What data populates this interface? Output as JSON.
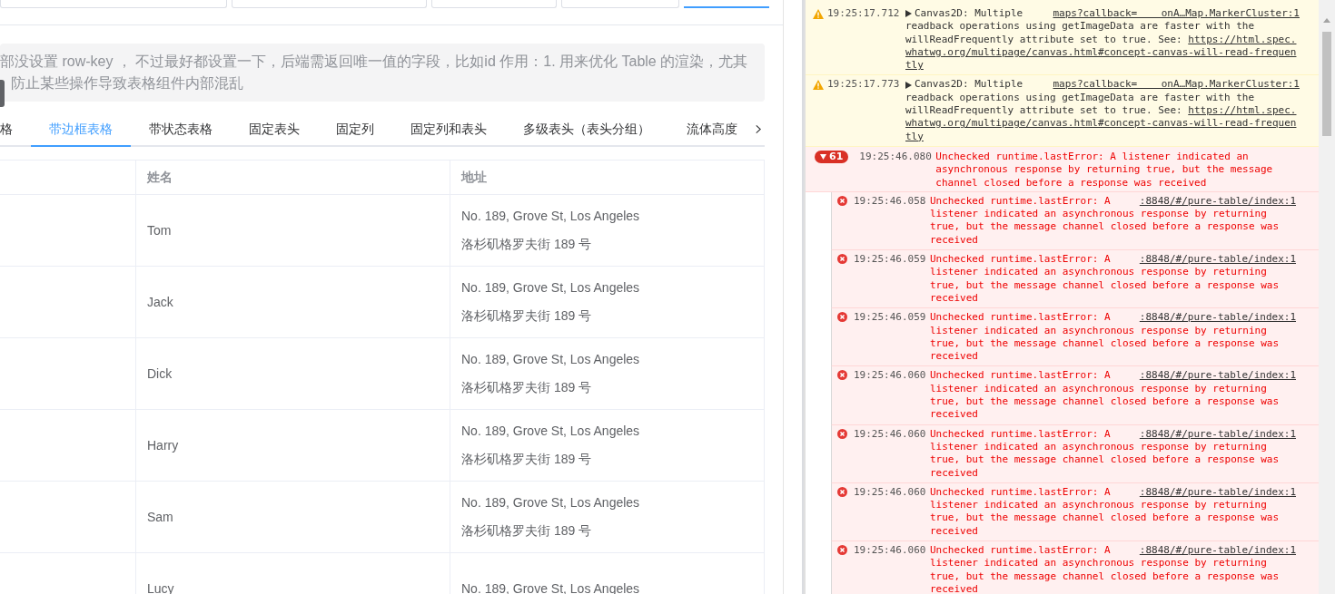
{
  "page_tabs": [
    {
      "selected": false
    },
    {
      "selected": false
    },
    {
      "selected": false
    },
    {
      "selected": false
    },
    {
      "selected": true
    }
  ],
  "note": {
    "text": "部没设置 row-key ， 不过最好都设置一下，后端需返回唯一值的字段，比如id 作用：1. 用来优化 Table 的渲染，尤其防止某些操作导致表格组件内部混乱"
  },
  "tabs": [
    {
      "label": "格",
      "selected": false
    },
    {
      "label": "带边框表格",
      "selected": true
    },
    {
      "label": "带状态表格",
      "selected": false
    },
    {
      "label": "固定表头",
      "selected": false
    },
    {
      "label": "固定列",
      "selected": false
    },
    {
      "label": "固定列和表头",
      "selected": false
    },
    {
      "label": "多级表头（表头分组）",
      "selected": false
    },
    {
      "label": "流体高度",
      "selected": false
    }
  ],
  "table": {
    "columns": [
      "姓名",
      "地址"
    ],
    "rows": [
      {
        "name": "Tom",
        "address": "No. 189, Grove St, Los Angeles",
        "address_zh": "洛杉矶格罗夫街 189 号"
      },
      {
        "name": "Jack",
        "address": "No. 189, Grove St, Los Angeles",
        "address_zh": "洛杉矶格罗夫街 189 号"
      },
      {
        "name": "Dick",
        "address": "No. 189, Grove St, Los Angeles",
        "address_zh": "洛杉矶格罗夫街 189 号"
      },
      {
        "name": "Harry",
        "address": "No. 189, Grove St, Los Angeles",
        "address_zh": "洛杉矶格罗夫街 189 号"
      },
      {
        "name": "Sam",
        "address": "No. 189, Grove St, Los Angeles",
        "address_zh": "洛杉矶格罗夫街 189 号"
      },
      {
        "name": "Lucy",
        "address": "No. 189, Grove St, Los Angeles"
      }
    ]
  },
  "console": [
    {
      "kind": "warning",
      "time": "19:25:17.712",
      "text_lines": [
        "Canvas2D: Multiple",
        "readback operations using getImageData are faster with the",
        "willReadFrequently attribute set to true. See:"
      ],
      "link_lines": [
        "https://html.spec.",
        "whatwg.org/multipage/canvas.html#concept-canvas-will-read-frequen",
        "tly"
      ],
      "source": "maps?callback=    onA…Map.MarkerCluster:1"
    },
    {
      "kind": "warning",
      "time": "19:25:17.773",
      "text_lines": [
        "Canvas2D: Multiple",
        "readback operations using getImageData are faster with the",
        "willReadFrequently attribute set to true. See:"
      ],
      "link_lines": [
        "https://html.spec.",
        "whatwg.org/multipage/canvas.html#concept-canvas-will-read-frequen",
        "tly"
      ],
      "source": "maps?callback=    onA…Map.MarkerCluster:1"
    },
    {
      "kind": "group",
      "count": "61",
      "expanded": true,
      "time": "19:25:46.080",
      "message": "Unchecked runtime.lastError: A listener indicated an asynchronous response by returning true, but the message channel closed before a response was received"
    },
    {
      "kind": "error",
      "time": "19:25:46.058",
      "first_line": "Unchecked runtime.lastError: A",
      "rest": "listener indicated an asynchronous response by returning true, but the message channel closed before a response was received",
      "source": ":8848/#/pure-table/index:1"
    },
    {
      "kind": "error",
      "time": "19:25:46.059",
      "first_line": "Unchecked runtime.lastError: A",
      "rest": "listener indicated an asynchronous response by returning true, but the message channel closed before a response was received",
      "source": ":8848/#/pure-table/index:1"
    },
    {
      "kind": "error",
      "time": "19:25:46.059",
      "first_line": "Unchecked runtime.lastError: A",
      "rest": "listener indicated an asynchronous response by returning true, but the message channel closed before a response was received",
      "source": ":8848/#/pure-table/index:1"
    },
    {
      "kind": "error",
      "time": "19:25:46.060",
      "first_line": "Unchecked runtime.lastError: A",
      "rest": "listener indicated an asynchronous response by returning true, but the message channel closed before a response was received",
      "source": ":8848/#/pure-table/index:1"
    },
    {
      "kind": "error",
      "time": "19:25:46.060",
      "first_line": "Unchecked runtime.lastError: A",
      "rest": "listener indicated an asynchronous response by returning true, but the message channel closed before a response was received",
      "source": ":8848/#/pure-table/index:1"
    },
    {
      "kind": "error",
      "time": "19:25:46.060",
      "first_line": "Unchecked runtime.lastError: A",
      "rest": "listener indicated an asynchronous response by returning true, but the message channel closed before a response was received",
      "source": ":8848/#/pure-table/index:1"
    },
    {
      "kind": "error",
      "time": "19:25:46.060",
      "first_line": "Unchecked runtime.lastError: A",
      "rest": "listener indicated an asynchronous response by returning true, but the message channel closed before a response was received",
      "source": ":8848/#/pure-table/index:1"
    }
  ]
}
